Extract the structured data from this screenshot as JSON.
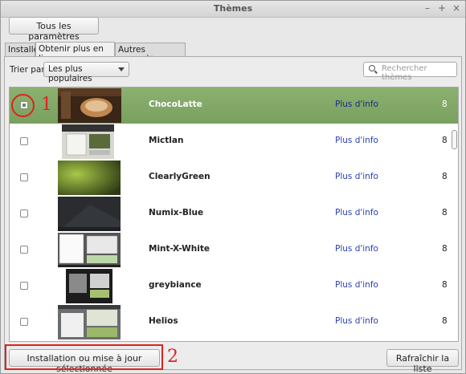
{
  "window": {
    "title": "Thèmes",
    "controls": [
      "–",
      "+",
      "×"
    ]
  },
  "toolbar": {
    "all_settings_label": "Tous les paramètres"
  },
  "tabs": [
    {
      "label": "Installé",
      "active": false
    },
    {
      "label": "Obtenir plus en ligne",
      "active": true
    },
    {
      "label": "Autres paramètres",
      "active": false
    }
  ],
  "sort": {
    "label": "Trier par",
    "selected": "Les plus populaires"
  },
  "search": {
    "placeholder": "Rechercher thèmes",
    "icon": "search-icon"
  },
  "themes": [
    {
      "name": "ChocoLatte",
      "info": "Plus d'info",
      "score": "8",
      "checked": true,
      "selected": true
    },
    {
      "name": "Mictlan",
      "info": "Plus d'info",
      "score": "8",
      "checked": false,
      "selected": false
    },
    {
      "name": "ClearlyGreen",
      "info": "Plus d'info",
      "score": "8",
      "checked": false,
      "selected": false
    },
    {
      "name": "Numix-Blue",
      "info": "Plus d'info",
      "score": "8",
      "checked": false,
      "selected": false
    },
    {
      "name": "Mint-X-White",
      "info": "Plus d'info",
      "score": "8",
      "checked": false,
      "selected": false
    },
    {
      "name": "greybiance",
      "info": "Plus d'info",
      "score": "8",
      "checked": false,
      "selected": false
    },
    {
      "name": "Helios",
      "info": "Plus d'info",
      "score": "8",
      "checked": false,
      "selected": false
    }
  ],
  "footer": {
    "install_label": "Installation ou mise à jour sélectionnée",
    "refresh_label": "Rafraîchir la liste"
  },
  "annotations": {
    "one": "1",
    "two": "2"
  },
  "colors": {
    "selection": "#7fa563",
    "link": "#2a3fb2",
    "annotation": "#dd2222"
  }
}
